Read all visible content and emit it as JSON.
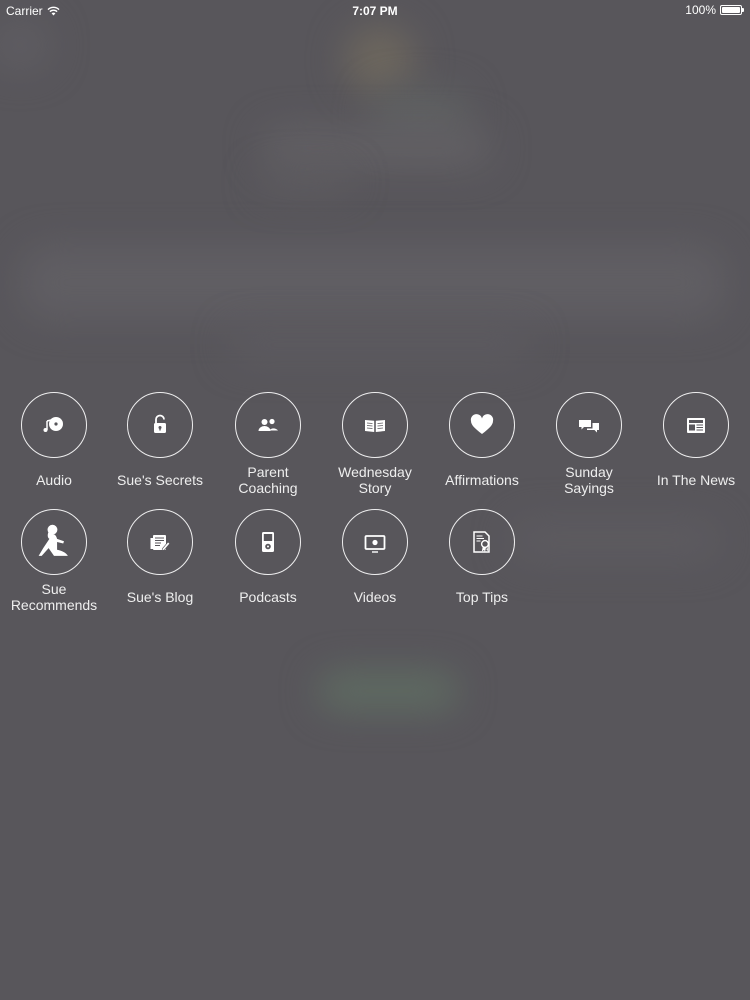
{
  "status_bar": {
    "carrier": "Carrier",
    "time": "7:07 PM",
    "battery_percent": "100%",
    "battery_level": 1.0
  },
  "menu": {
    "items": [
      {
        "label": "Audio",
        "icon": "music-disc-icon"
      },
      {
        "label": "Sue's Secrets",
        "icon": "padlock-icon"
      },
      {
        "label": "Parent\nCoaching",
        "icon": "people-icon"
      },
      {
        "label": "Wednesday\nStory",
        "icon": "open-book-icon"
      },
      {
        "label": "Affirmations",
        "icon": "heart-icon"
      },
      {
        "label": "Sunday\nSayings",
        "icon": "chat-bubbles-icon"
      },
      {
        "label": "In The News",
        "icon": "newspaper-icon"
      },
      {
        "label": "Sue\nRecommends",
        "icon": "sitting-woman-icon"
      },
      {
        "label": "Sue's Blog",
        "icon": "blog-post-icon"
      },
      {
        "label": "Podcasts",
        "icon": "ipod-icon"
      },
      {
        "label": "Videos",
        "icon": "video-screen-icon"
      },
      {
        "label": "Top Tips",
        "icon": "certificate-icon"
      }
    ]
  },
  "colors": {
    "overlay": "#58565b",
    "icon": "#ffffff"
  }
}
